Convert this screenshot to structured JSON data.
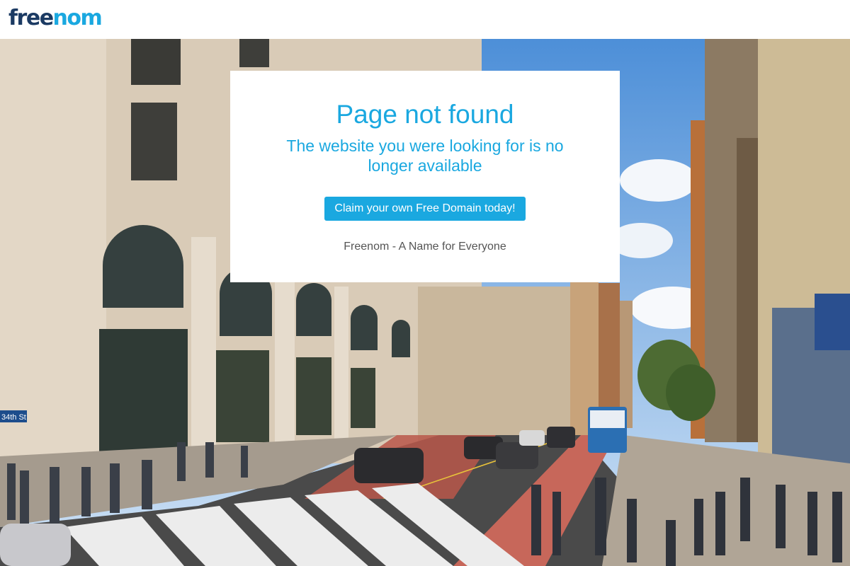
{
  "header": {
    "logo_part1": "free",
    "logo_part2": "nom"
  },
  "card": {
    "title": "Page not found",
    "subtitle": "The website you were looking for is no longer available",
    "cta_label": "Claim your own Free Domain today!",
    "tagline": "Freenom - A Name for Everyone"
  },
  "background": {
    "street_sign": "34th St"
  },
  "colors": {
    "accent": "#1aa8e0",
    "logo_dark": "#1b3a63",
    "tagline": "#555555"
  }
}
